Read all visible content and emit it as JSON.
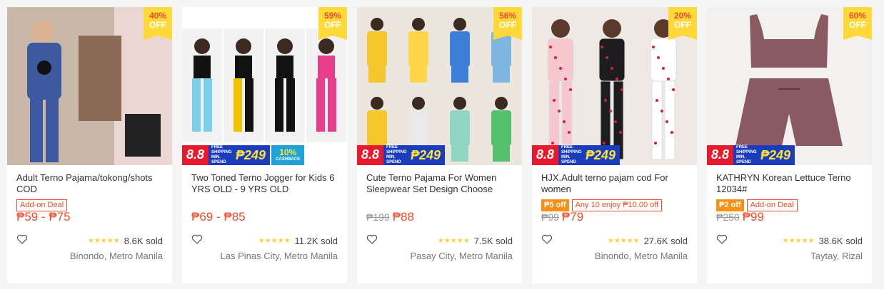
{
  "products": [
    {
      "discount_pct": "40%",
      "discount_off": "OFF",
      "title": "Adult Terno Pajama/tokong/shots COD",
      "tags": [
        {
          "kind": "addon",
          "text": "Add-on Deal"
        }
      ],
      "old_price": "",
      "price": "₱59 - ₱75",
      "rating_stars": "★★★★★",
      "rating": 5,
      "sold": "8.6K sold",
      "location": "Binondo, Metro Manila",
      "promo": null,
      "image_icon": "pajama-product-photo",
      "colors": {
        "bg": "#c9b8a8",
        "main": "#3d5aa0"
      }
    },
    {
      "discount_pct": "59%",
      "discount_off": "OFF",
      "title": "Two Toned Terno Jogger for Kids 6 YRS OLD - 9 YRS OLD",
      "tags": [],
      "old_price": "",
      "price": "₱69 - ₱85",
      "rating_stars": "★★★★★",
      "rating": 5,
      "sold": "11.2K sold",
      "location": "Las Pinas City, Metro Manila",
      "promo": {
        "event": "8.8",
        "ship_text": "FREE SHIPPING",
        "ship_min": "MIN. SPEND",
        "ship_amt": "₱249",
        "cash_pct": "10%",
        "cash_text": "CASHBACK"
      },
      "image_icon": "kids-jogger-photo",
      "colors": {
        "bg": "#ffffff",
        "main": "#111111"
      }
    },
    {
      "discount_pct": "56%",
      "discount_off": "OFF",
      "title": "Cute Terno Pajama For Women Sleepwear Set Design Choose",
      "tags": [],
      "old_price": "₱199",
      "price": "₱88",
      "rating_stars": "★★★★★",
      "rating": 5,
      "sold": "7.5K sold",
      "location": "Pasay City, Metro Manila",
      "promo": {
        "event": "8.8",
        "ship_text": "FREE SHIPPING",
        "ship_min": "MIN. SPEND",
        "ship_amt": "₱249",
        "cash_pct": "",
        "cash_text": ""
      },
      "image_icon": "sleepwear-grid-photo",
      "colors": {
        "bg": "#e9e5df",
        "main": "#f4c82c"
      }
    },
    {
      "discount_pct": "20%",
      "discount_off": "OFF",
      "title": "HJX.Adult terno pajam cod For women",
      "tags": [
        {
          "kind": "off",
          "text": "₱5 off"
        },
        {
          "kind": "any",
          "text": "Any 10 enjoy ₱10.00 off"
        }
      ],
      "old_price": "₱99",
      "price": "₱79",
      "rating_stars": "★★★★★",
      "rating": 5,
      "sold": "27.6K sold",
      "location": "Binondo, Metro Manila",
      "promo": {
        "event": "8.8",
        "ship_text": "FREE SHIPPING",
        "ship_min": "MIN. SPEND",
        "ship_amt": "₱249",
        "cash_pct": "",
        "cash_text": ""
      },
      "image_icon": "cherry-pajama-photo",
      "colors": {
        "bg": "#efe9e6",
        "main": "#f2b6c0"
      }
    },
    {
      "discount_pct": "60%",
      "discount_off": "OFF",
      "title": "KATHRYN Korean Lettuce Terno 12034#",
      "tags": [
        {
          "kind": "off",
          "text": "₱2 off"
        },
        {
          "kind": "addon",
          "text": "Add-on Deal"
        }
      ],
      "old_price": "₱250",
      "price": "₱99",
      "rating_stars": "★★★★★",
      "rating": 5,
      "sold": "38.6K sold",
      "location": "Taytay, Rizal",
      "promo": {
        "event": "8.8",
        "ship_text": "FREE SHIPPING",
        "ship_min": "MIN. SPEND",
        "ship_amt": "₱249",
        "cash_pct": "",
        "cash_text": ""
      },
      "image_icon": "lettuce-terno-photo",
      "colors": {
        "bg": "#f3f1f0",
        "main": "#8a5a62"
      }
    }
  ],
  "heart_icon": "heart-outline-icon"
}
